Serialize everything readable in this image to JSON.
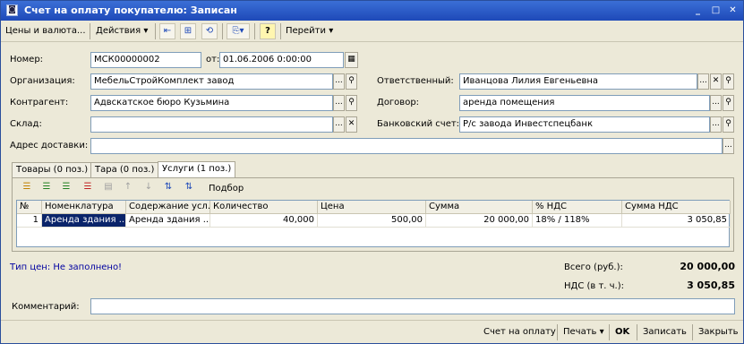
{
  "window": {
    "title": "Счет на оплату покупателю: Записан",
    "controls": {
      "minimize": "_",
      "maximize": "□",
      "close": "✕"
    }
  },
  "toolbar": {
    "prices_label": "Цены и валюта...",
    "actions_label": "Действия",
    "help_label": "?",
    "goto_label": "Перейти"
  },
  "form": {
    "number_label": "Номер:",
    "number_value": "МСК00000002",
    "from_label": "от:",
    "date_value": "01.06.2006  0:00:00",
    "organization_label": "Организация:",
    "organization_value": "МебельСтройКомплект завод",
    "responsible_label": "Ответственный:",
    "responsible_value": "Иванцова Лилия Евгеньевна",
    "counterparty_label": "Контрагент:",
    "counterparty_value": "Адвскатское бюро Кузьмина",
    "contract_label": "Договор:",
    "contract_value": "аренда помещения",
    "warehouse_label": "Склад:",
    "warehouse_value": "",
    "bank_label": "Банковский счет:",
    "bank_value": "Р/с завода Инвестспецбанк",
    "address_label": "Адрес доставки:",
    "address_value": "",
    "ellipsis": "...",
    "search": "🔍",
    "clear": "✕"
  },
  "tabs": [
    {
      "label": "Товары (0 поз.)"
    },
    {
      "label": "Тара (0 поз.)"
    },
    {
      "label": "Услуги (1 поз.)"
    }
  ],
  "tab_toolbar": {
    "selection_label": "Подбор"
  },
  "table": {
    "headers": [
      "№",
      "Номенклатура",
      "Содержание усл...",
      "Количество",
      "Цена",
      "Сумма",
      "% НДС",
      "Сумма НДС"
    ],
    "rows": [
      [
        "1",
        "Аренда здания ...",
        "Аренда здания ...",
        "40,000",
        "500,00",
        "20 000,00",
        "18% / 118%",
        "3 050,85"
      ]
    ]
  },
  "summary": {
    "price_type": "Тип цен: Не заполнено!",
    "total_label": "Всего (руб.):",
    "total_value": "20 000,00",
    "vat_label": "НДС (в т. ч.):",
    "vat_value": "3 050,85"
  },
  "comment": {
    "label": "Комментарий:",
    "value": ""
  },
  "bottom": {
    "invoice_label": "Счет на оплату",
    "print_label": "Печать",
    "ok_label": "OK",
    "save_label": "Записать",
    "close_label": "Закрыть"
  },
  "colors": {
    "titlebar": "#1e49b8",
    "background": "#ece9d8",
    "selection": "#0a246a",
    "price_type_text": "#0000a0"
  }
}
